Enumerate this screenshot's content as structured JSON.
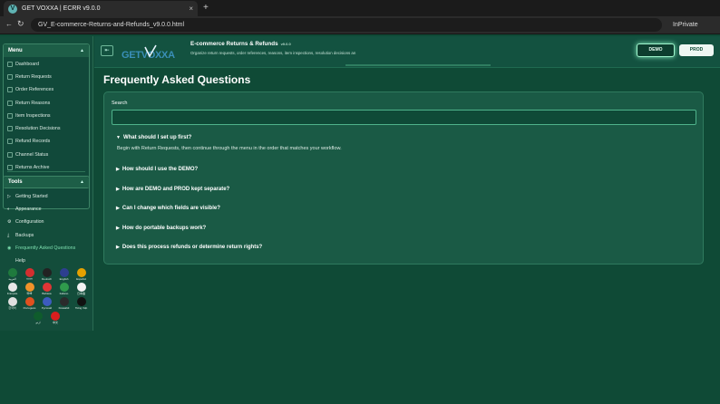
{
  "browser": {
    "tab_title": "GET VOXXA | ECRR v9.0.0",
    "tab_icon": "V",
    "close_glyph": "×",
    "newtab_glyph": "+",
    "back_glyph": "←",
    "reload_glyph": "↻",
    "url": "GV_E-commerce-Returns-and-Refunds_v9.0.0.html",
    "mode_label": "InPrivate"
  },
  "sidebar": {
    "menu_title": "Menu",
    "menu_items": [
      {
        "label": "Dashboard",
        "icon": "dashboard-icon"
      },
      {
        "label": "Return Requests",
        "icon": "requests-icon"
      },
      {
        "label": "Order References",
        "icon": "orders-icon"
      },
      {
        "label": "Return Reasons",
        "icon": "reasons-icon"
      },
      {
        "label": "Item Inspections",
        "icon": "inspection-icon"
      },
      {
        "label": "Resolution Decisions",
        "icon": "decision-icon"
      },
      {
        "label": "Refund Records",
        "icon": "refund-icon"
      },
      {
        "label": "Channel Status",
        "icon": "channel-icon"
      },
      {
        "label": "Returns Archive",
        "icon": "archive-icon"
      }
    ],
    "tools_title": "Tools",
    "tools_items": [
      {
        "label": "Getting Started",
        "glyph": "▷"
      },
      {
        "label": "Appearance",
        "glyph": "◐"
      },
      {
        "label": "Configuration",
        "glyph": "⚙"
      },
      {
        "label": "Backups",
        "glyph": "⤓"
      },
      {
        "label": "Frequently Asked Questions",
        "glyph": "◉",
        "active": true
      },
      {
        "label": "Help",
        "glyph": ""
      }
    ],
    "flags": [
      {
        "label": "العربية",
        "color": "#1f7a3d"
      },
      {
        "label": "বাংলা",
        "color": "#d32f2f"
      },
      {
        "label": "Deutsch",
        "color": "#222222"
      },
      {
        "label": "English",
        "color": "#2d3f8f"
      },
      {
        "label": "Español",
        "color": "#e5a100"
      },
      {
        "label": "Français",
        "color": "#e8e8e8"
      },
      {
        "label": "हिन्दी",
        "color": "#f0922a"
      },
      {
        "label": "Bahasa",
        "color": "#e03535"
      },
      {
        "label": "Italiano",
        "color": "#2f9a4c"
      },
      {
        "label": "日本語",
        "color": "#f2f2f2"
      },
      {
        "label": "한국어",
        "color": "#e0e0e0"
      },
      {
        "label": "Português",
        "color": "#e0501f"
      },
      {
        "label": "Русский",
        "color": "#3d5bbf"
      },
      {
        "label": "Kiswahili",
        "color": "#2b2b2b"
      },
      {
        "label": "Tiếng Việt",
        "color": "#111111"
      },
      {
        "label": "اردو",
        "color": "#0f5c2c"
      },
      {
        "label": "中文",
        "color": "#d91e1e"
      }
    ],
    "collapse_glyph": "▲"
  },
  "header": {
    "sidebar_toggle_glyph": "⇤",
    "logo_text": "GETVOXXA",
    "title": "E-commerce Returns & Refunds",
    "version": "v9.0.0",
    "subtitle": "Organize return requests, order references, reasons, item inspections, resolution decisions an",
    "demo_label": "DEMO",
    "prod_label": "PROD"
  },
  "main": {
    "page_title": "Frequently Asked Questions",
    "search_label": "Search",
    "search_value": "",
    "open_arrow": "▼",
    "closed_arrow": "▶",
    "faqs": [
      {
        "q": "What should I set up first?",
        "open": true,
        "a": "Begin with Return Requests, then continue through the menu in the order that matches your workflow."
      },
      {
        "q": "How should I use the DEMO?",
        "open": false
      },
      {
        "q": "How are DEMO and PROD kept separate?",
        "open": false
      },
      {
        "q": "Can I change which fields are visible?",
        "open": false
      },
      {
        "q": "How do portable backups work?",
        "open": false
      },
      {
        "q": "Does this process refunds or determine return rights?",
        "open": false
      }
    ]
  },
  "colors": {
    "page_bg": "#0f4a36",
    "accent": "#7ee0b0",
    "demo_glow": "#86f0c0"
  }
}
